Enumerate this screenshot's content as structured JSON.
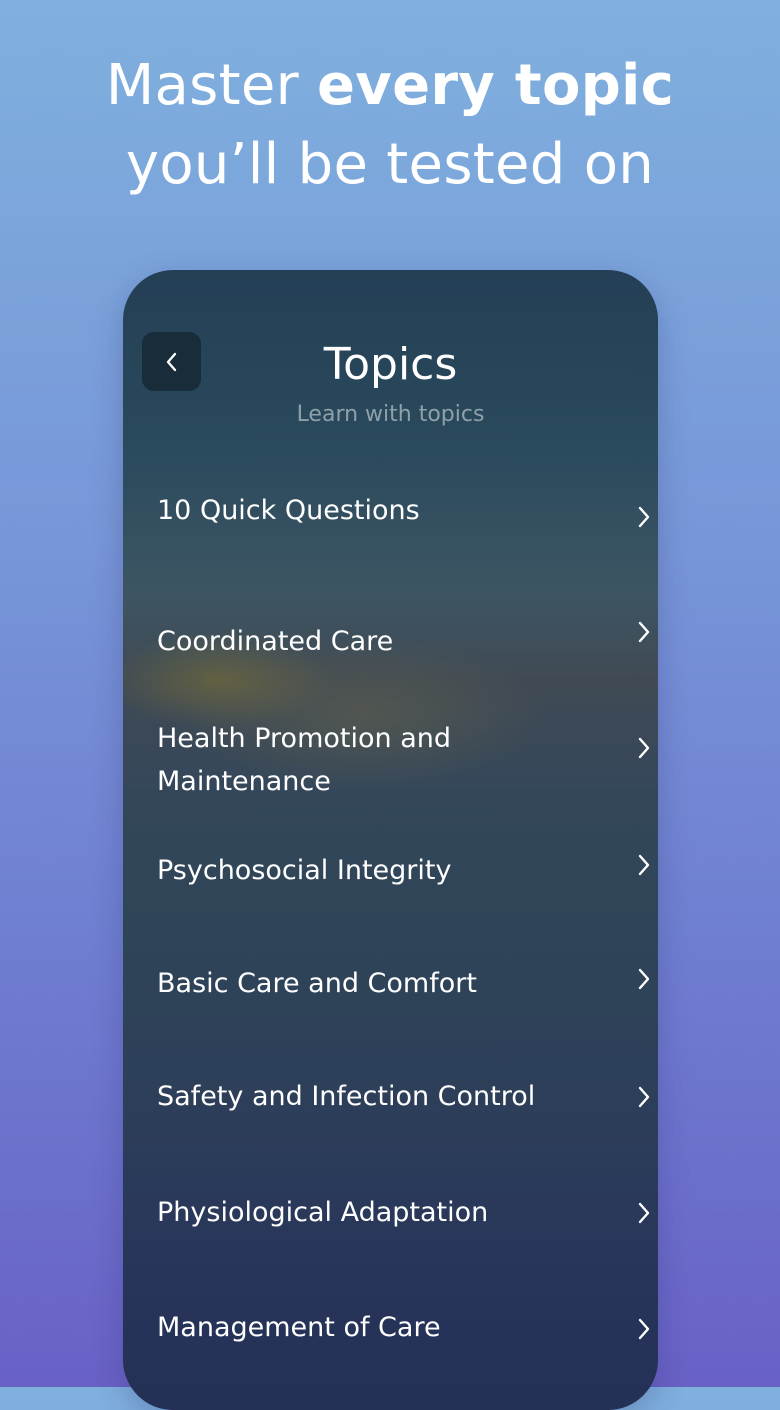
{
  "headline": {
    "line1_regular": "Master ",
    "line1_bold": "every topic",
    "line2": "you’ll be tested on"
  },
  "screen": {
    "title": "Topics",
    "subtitle": "Learn with topics",
    "back_icon": "chevron-left-icon"
  },
  "topics": [
    {
      "label": "10 Quick Questions"
    },
    {
      "label": "Coordinated Care"
    },
    {
      "label": "Health Promotion and Maintenance"
    },
    {
      "label": "Psychosocial Integrity"
    },
    {
      "label": "Basic Care and Comfort"
    },
    {
      "label": "Safety and Infection Control"
    },
    {
      "label": "Physiological Adaptation"
    },
    {
      "label": "Management of Care"
    }
  ],
  "colors": {
    "accent_text": "#ffffff",
    "subtitle": "#8fa0aa"
  }
}
